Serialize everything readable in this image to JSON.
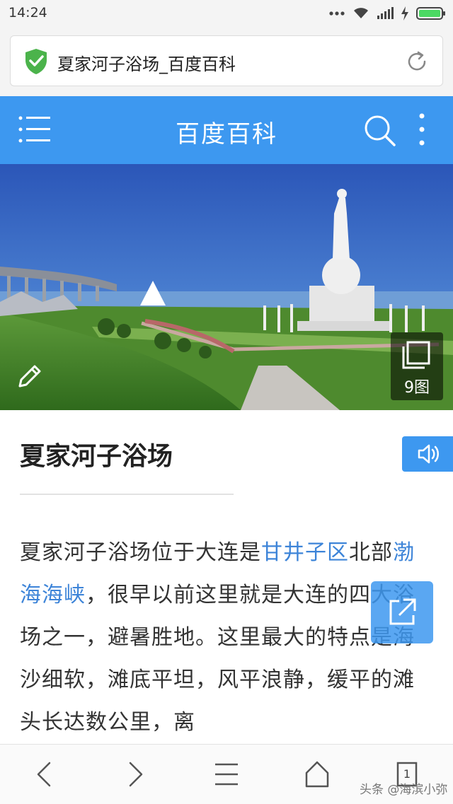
{
  "status_bar": {
    "time": "14:24",
    "icons": [
      "more-dots-icon",
      "wifi-icon",
      "signal-icon",
      "charging-icon",
      "battery-icon"
    ]
  },
  "address_bar": {
    "page_title": "夏家河子浴场_百度百科",
    "security_icon": "shield-check-icon",
    "reload_icon": "reload-icon"
  },
  "header": {
    "title": "百度百科",
    "menu_icon": "menu-icon",
    "search_icon": "search-icon",
    "more_icon": "more-vertical-icon",
    "color": "#3d98f0"
  },
  "hero": {
    "edit_icon": "pencil-icon",
    "gallery_icon": "gallery-icon",
    "gallery_count": "9图"
  },
  "entry": {
    "title": "夏家河子浴场",
    "audio_icon": "speaker-icon"
  },
  "article": {
    "t1": "夏家河子浴场位于大连是",
    "link1": "甘井子区",
    "t2": "北部",
    "link2": "渤海海峡",
    "t3": "，很早以前这里就是大连的四大浴场之一，避暑胜地。这里最大的特点是海沙细软，滩底平坦，风平浪静，缓平的滩头长达数公里，离",
    "link_color": "#3d84d8"
  },
  "share_icon": "share-external-icon",
  "bottom_nav": {
    "items": [
      "back-icon",
      "forward-icon",
      "menu-icon",
      "home-icon",
      "tabs-icon"
    ],
    "tab_count": "1"
  },
  "watermark": "头条 @海滨小弥"
}
